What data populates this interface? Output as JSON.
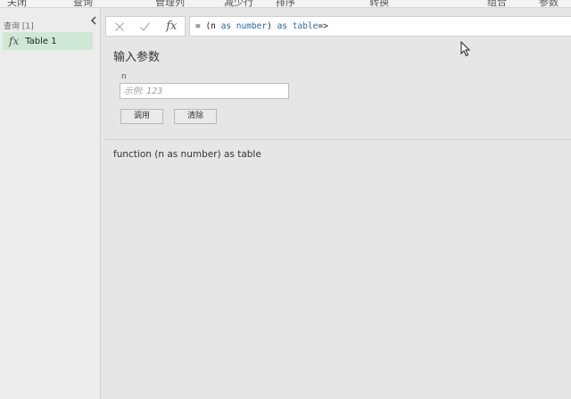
{
  "ribbon": {
    "tabs": [
      "关闭",
      "查询",
      "管理列",
      "减少行",
      "排序",
      "转换",
      "组合",
      "参数"
    ]
  },
  "queries": {
    "header": "查询 [1]",
    "collapse_icon": "chevron-left-icon",
    "items": [
      {
        "icon": "fx-icon",
        "icon_text": "fx",
        "label": "Table 1",
        "selected": true
      }
    ]
  },
  "formula_bar": {
    "cancel_icon": "close-icon",
    "commit_icon": "check-icon",
    "fx_icon_text": "fx",
    "formula_parts": [
      "= (n ",
      "as",
      " ",
      "number",
      ") ",
      "as",
      " ",
      "table",
      "=>"
    ]
  },
  "parameter_panel": {
    "title": "输入参数",
    "param_name": "n",
    "param_placeholder": "示例: 123",
    "invoke_label": "调用",
    "clear_label": "清除",
    "signature": "function (n as number) as table"
  },
  "colors": {
    "selected_query_bg": "#cfe8d6",
    "keyword_blue": "#1e5fb0"
  }
}
